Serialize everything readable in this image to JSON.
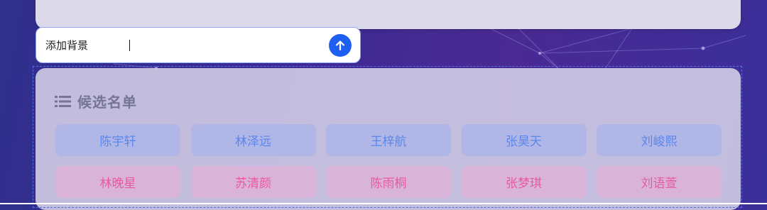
{
  "input": {
    "value": "添加背景"
  },
  "roster": {
    "title": "候选名单",
    "male": [
      "陈宇轩",
      "林泽远",
      "王梓航",
      "张昊天",
      "刘峻熙"
    ],
    "female": [
      "林晚星",
      "苏清颜",
      "陈雨桐",
      "张梦琪",
      "刘语萱"
    ]
  },
  "icons": {
    "send": "arrow-up-icon",
    "list": "list-icon"
  },
  "colors": {
    "accent": "#1e5ff0",
    "male_text": "#5a86ec",
    "female_text": "#e85a9e"
  }
}
